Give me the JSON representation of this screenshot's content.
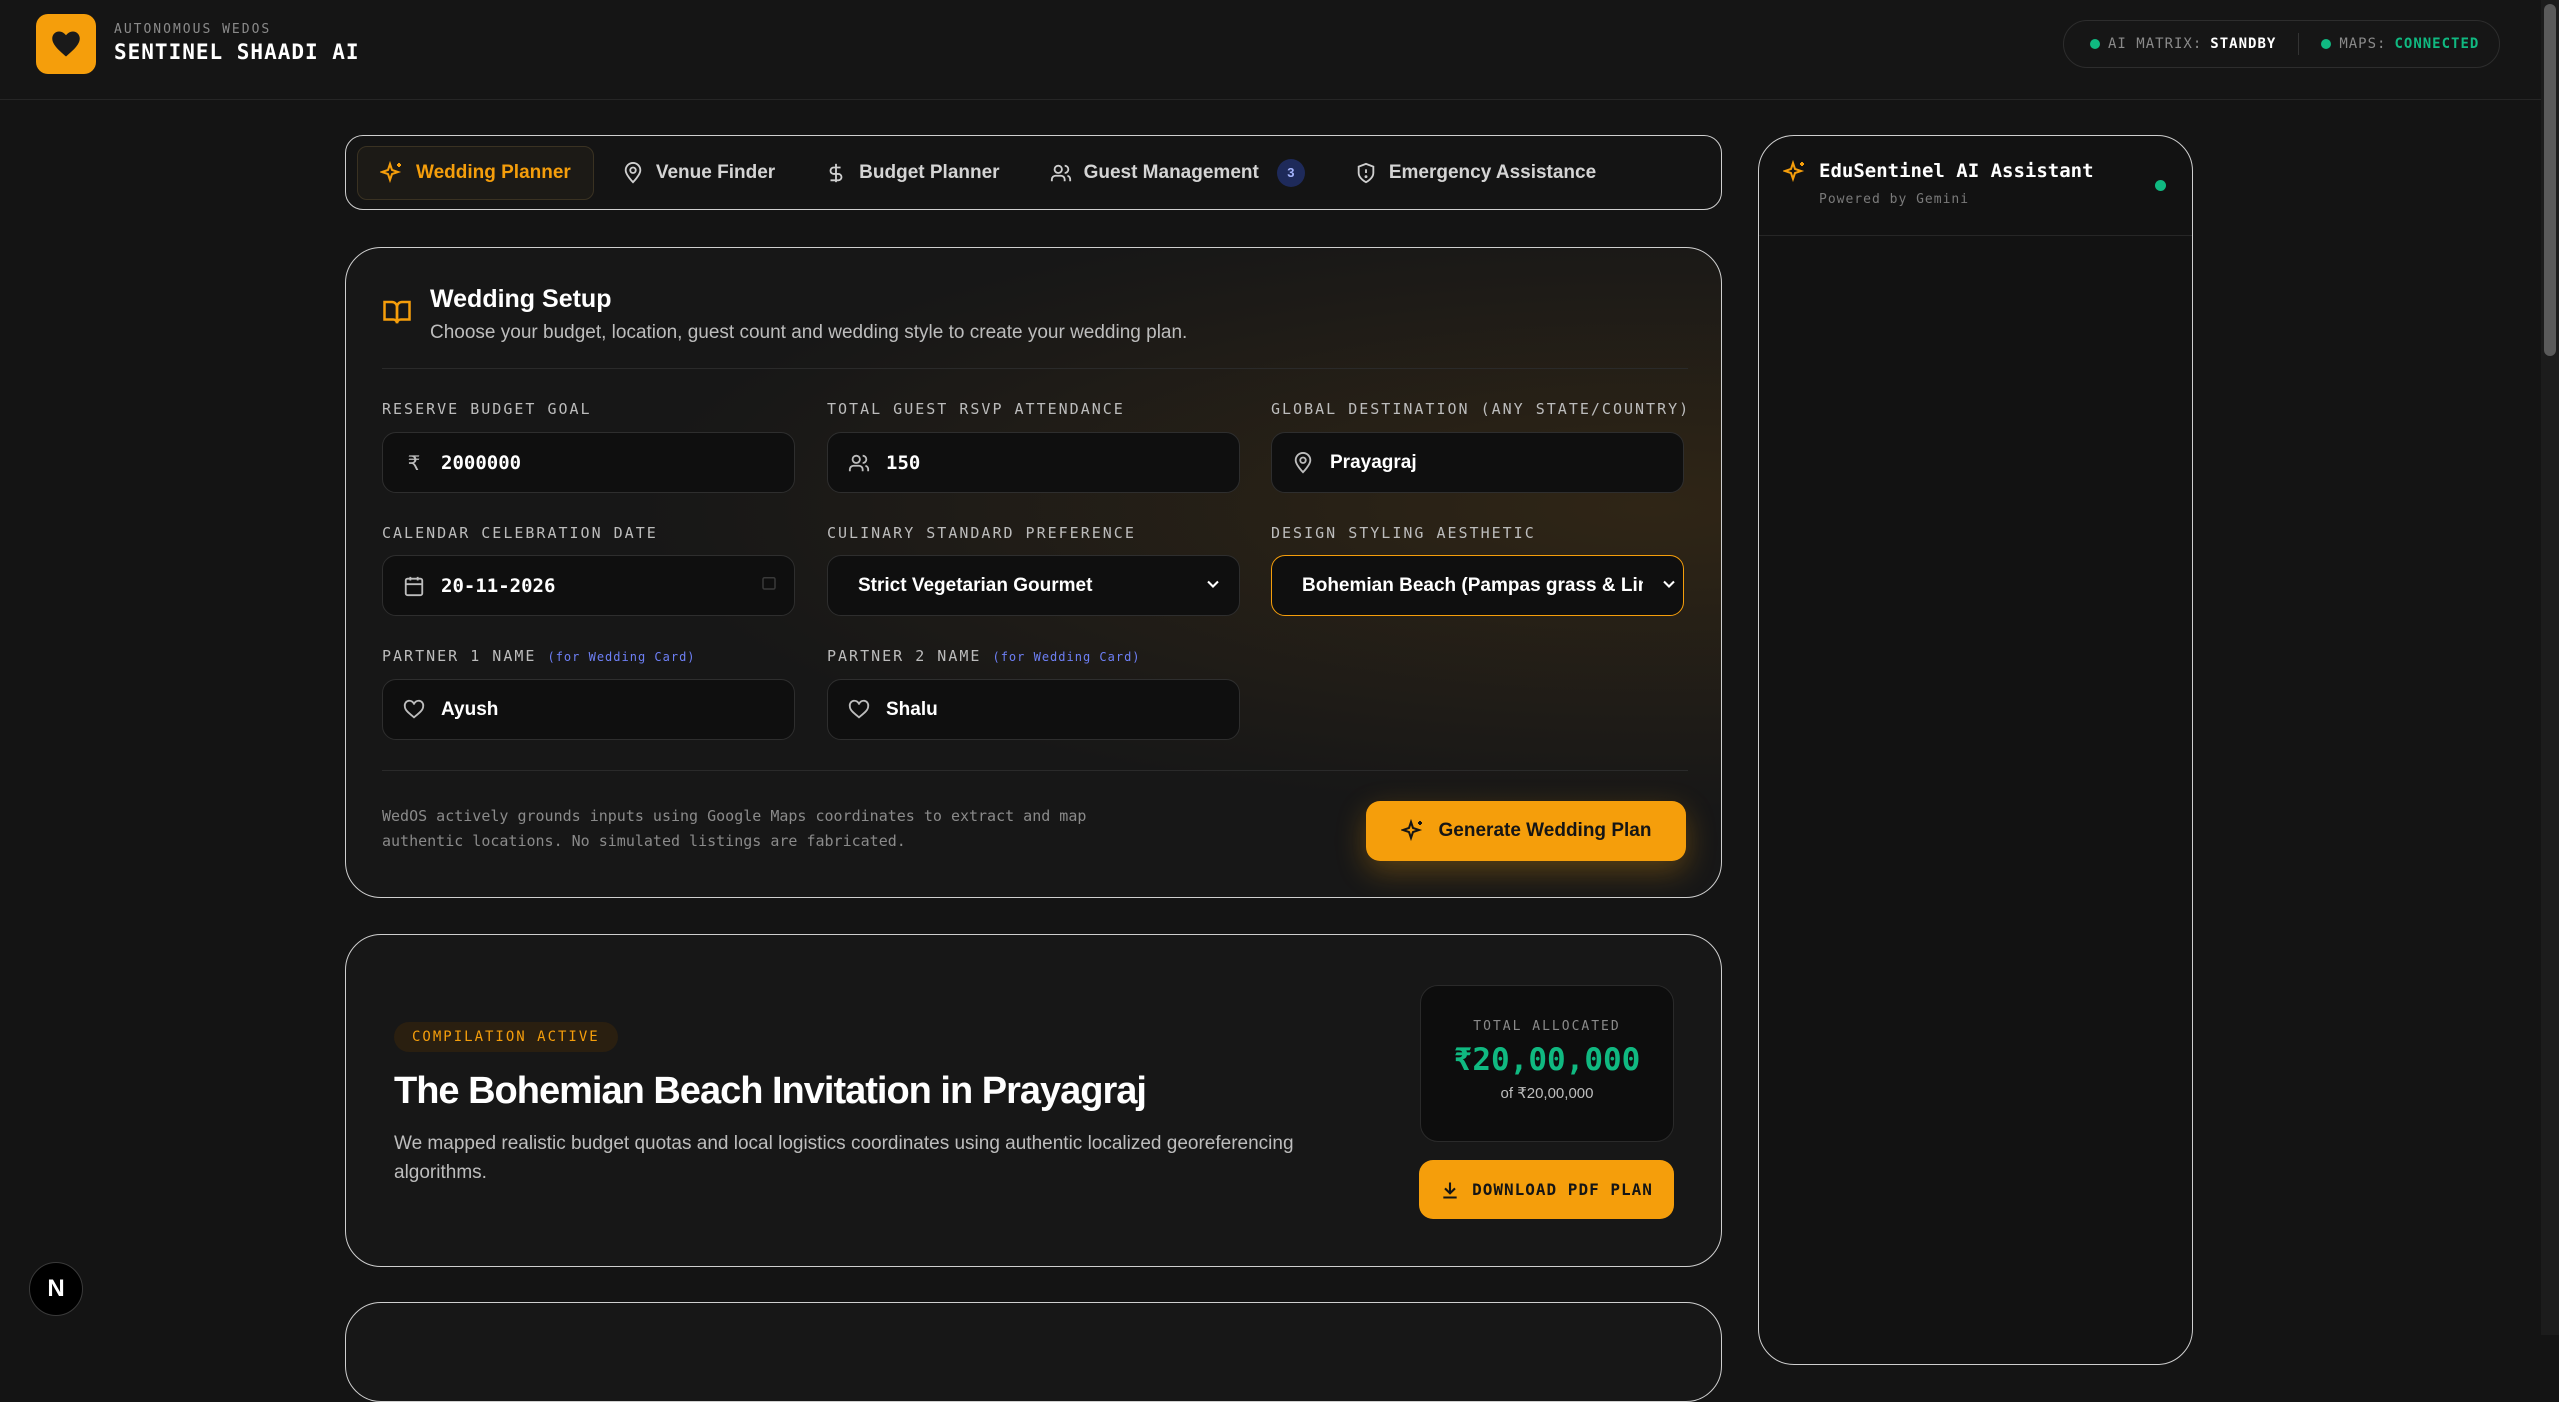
{
  "header": {
    "brand_sub": "AUTONOMOUS WEDOS",
    "brand_title": "SENTINEL SHAADI AI",
    "status": {
      "ai_label": "AI MATRIX:",
      "ai_value": "STANDBY",
      "maps_label": "MAPS:",
      "maps_value": "CONNECTED"
    }
  },
  "tabs": [
    {
      "label": "Wedding Planner",
      "icon": "sparkles-icon",
      "active": true
    },
    {
      "label": "Venue Finder",
      "icon": "map-pin-icon"
    },
    {
      "label": "Budget Planner",
      "icon": "dollar-icon"
    },
    {
      "label": "Guest Management",
      "icon": "users-icon",
      "badge": "3"
    },
    {
      "label": "Emergency Assistance",
      "icon": "shield-icon"
    }
  ],
  "setup": {
    "title": "Wedding Setup",
    "description": "Choose your budget, location, guest count and wedding style to create your wedding plan.",
    "fields": {
      "budget": {
        "label": "RESERVE BUDGET GOAL",
        "value": "2000000",
        "icon": "rupee-icon"
      },
      "guests": {
        "label": "TOTAL GUEST RSVP ATTENDANCE",
        "value": "150",
        "icon": "users-icon"
      },
      "destination": {
        "label": "GLOBAL DESTINATION (ANY STATE/COUNTRY)",
        "value": "Prayagraj",
        "icon": "map-pin-icon"
      },
      "date": {
        "label": "CALENDAR CELEBRATION DATE",
        "value": "20-11-2026",
        "icon": "calendar-icon"
      },
      "culinary": {
        "label": "CULINARY STANDARD PREFERENCE",
        "value": "Strict Vegetarian Gourmet"
      },
      "design": {
        "label": "DESIGN STYLING AESTHETIC",
        "value": "Bohemian Beach (Pampas grass & Linens"
      },
      "partner1": {
        "label": "PARTNER 1 NAME",
        "note": "(for Wedding Card)",
        "value": "Ayush",
        "icon": "heart-icon"
      },
      "partner2": {
        "label": "PARTNER 2 NAME",
        "note": "(for Wedding Card)",
        "value": "Shalu",
        "icon": "heart-icon"
      }
    },
    "footnote": "WedOS actively grounds inputs using Google Maps coordinates to extract and map authentic locations. No simulated listings are fabricated.",
    "generate_label": "Generate Wedding Plan"
  },
  "result": {
    "badge": "COMPILATION ACTIVE",
    "title": "The Bohemian Beach Invitation in Prayagraj",
    "description": "We mapped realistic budget quotas and local logistics coordinates using authentic localized georeferencing algorithms.",
    "alloc_label": "TOTAL ALLOCATED",
    "alloc_amount": "₹20,00,000",
    "alloc_sub": "of ₹20,00,000",
    "download_label": "DOWNLOAD PDF PLAN"
  },
  "assistant": {
    "title": "EduSentinel AI Assistant",
    "subtitle": "Powered by Gemini"
  },
  "colors": {
    "accent": "#f59e0b",
    "success": "#10b981",
    "background": "#141414"
  }
}
